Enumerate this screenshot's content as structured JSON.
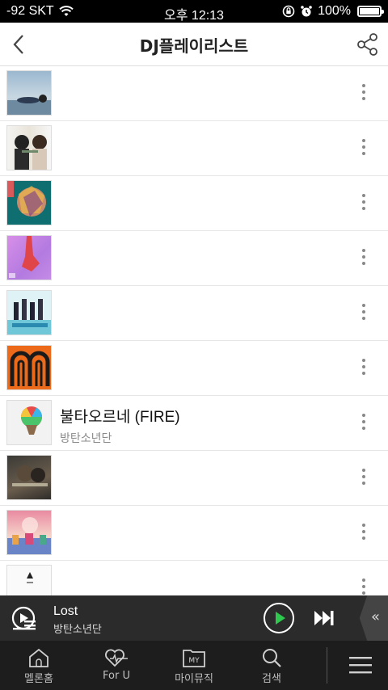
{
  "status_bar": {
    "carrier": "-92 SKT",
    "time": "오후 12:13",
    "battery": "100%"
  },
  "header": {
    "title": "DJ플레이리스트"
  },
  "list": {
    "rows": [
      {
        "title": "",
        "artist": ""
      },
      {
        "title": "",
        "artist": ""
      },
      {
        "title": "",
        "artist": ""
      },
      {
        "title": "",
        "artist": ""
      },
      {
        "title": "",
        "artist": ""
      },
      {
        "title": "",
        "artist": ""
      },
      {
        "title": "불타오르네 (FIRE)",
        "artist": "방탄소년단"
      },
      {
        "title": "",
        "artist": ""
      },
      {
        "title": "",
        "artist": ""
      },
      {
        "title": "",
        "artist": ""
      }
    ]
  },
  "player": {
    "title": "Lost",
    "artist": "방탄소년단",
    "play_color": "#2dc84d"
  },
  "bottom_nav": {
    "items": [
      {
        "label": "멜론홈",
        "icon": "home-icon"
      },
      {
        "label": "For U",
        "icon": "heart-icon"
      },
      {
        "label": "마이뮤직",
        "icon": "my-music-icon"
      },
      {
        "label": "검색",
        "icon": "search-icon"
      }
    ],
    "my_badge": "MY"
  }
}
